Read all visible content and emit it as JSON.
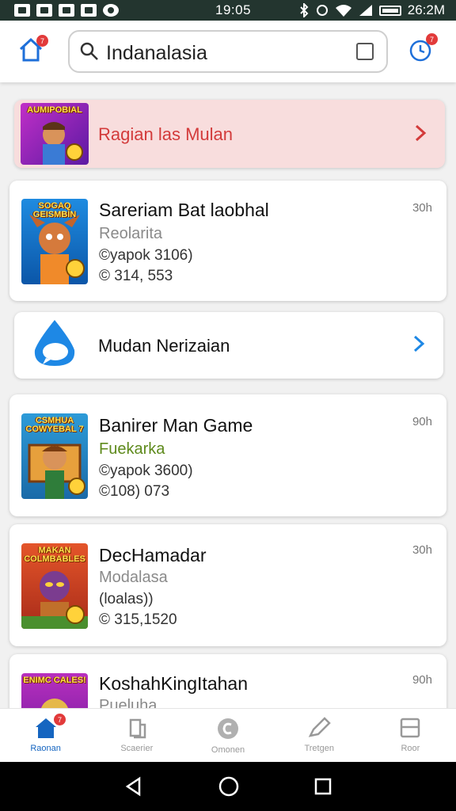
{
  "status_bar": {
    "time_center": "19:05",
    "time_right": "26:2M"
  },
  "header": {
    "home_badge": "7",
    "search_value": "Indanalasia",
    "clock_badge": "7"
  },
  "promo": {
    "thumb_title": "AUMIPOBIAL",
    "label": "Ragian las Mulan",
    "color": "#d33b3b"
  },
  "items": [
    {
      "thumb_title": "SOGAQ GEISMBIN",
      "title": "Sareriam Bat laobhal",
      "subtitle": "Reolarita",
      "line1": "©yapok 3106)",
      "line2": "© 314, 553",
      "time": "30h"
    },
    {
      "thumb_title": "CSMHUA COWYEBAL 7",
      "title": "Banirer Man Game",
      "subtitle": "Fuekarka",
      "line1": "©yapok 3600)",
      "line2": "©108) 073",
      "time": "90h"
    },
    {
      "thumb_title": "MAKAN COLMBABLES",
      "title": "DecHamadar",
      "subtitle": "Modalasa",
      "line1": "(loalas))",
      "line2": "© 315,1520",
      "time": "30h"
    },
    {
      "thumb_title": "ENIMC CALES!",
      "title": "KoshahKingItahan",
      "subtitle": "Pueluha",
      "time": "90h"
    }
  ],
  "link_card": {
    "label": "Mudan Nerizaian",
    "accent": "#1e88e5"
  },
  "bottom_nav": [
    {
      "label": "Raonan",
      "icon": "home-icon",
      "badge": "7"
    },
    {
      "label": "Scaerier",
      "icon": "bookmark-icon"
    },
    {
      "label": "Omonen",
      "icon": "coin-icon"
    },
    {
      "label": "Tretgen",
      "icon": "edit-icon"
    },
    {
      "label": "Roor",
      "icon": "menu-icon"
    }
  ]
}
